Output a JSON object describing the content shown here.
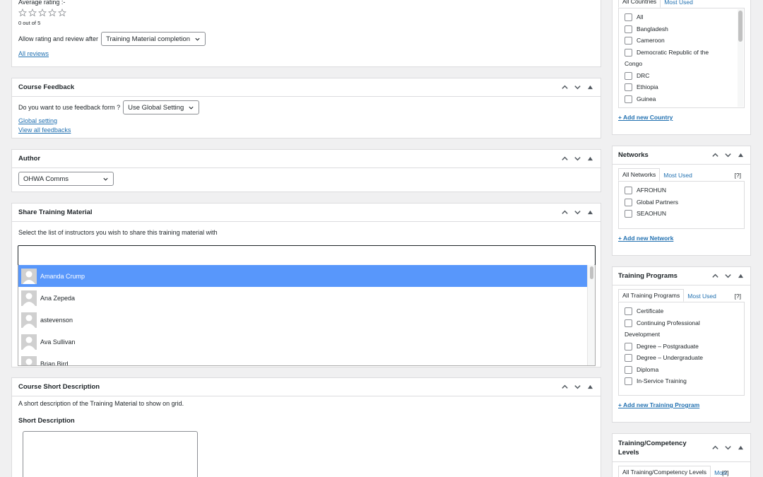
{
  "rating": {
    "avg_label": "Average rating :-",
    "stars": 5,
    "score_text": "0 out of 5",
    "allow_label": "Allow rating and review after",
    "allow_value": "Training Material completion",
    "all_reviews": "All reviews"
  },
  "feedback": {
    "title": "Course Feedback",
    "question": "Do you want to use feedback form ?",
    "value": "Use Global Setting",
    "global_link": "Global setting",
    "view_link": "View all feedbacks"
  },
  "author": {
    "title": "Author",
    "value": "OHWA Comms"
  },
  "share": {
    "title": "Share Training Material",
    "desc": "Select the list of instructors you wish to share this training material with",
    "instructors": [
      "Amanda Crump",
      "Ana Zepeda",
      "astevenson",
      "Ava Sullivan",
      "Brian Bird"
    ]
  },
  "short_desc": {
    "title": "Course Short Description",
    "desc": "A short description of the Training Material to show on grid.",
    "label": "Short Description"
  },
  "countries": {
    "tab_all": "All Countries",
    "tab_most": "Most Used",
    "items": [
      "All",
      "Bangladesh",
      "Cameroon",
      "Democratic Republic of the",
      "Congo",
      "DRC",
      "Ethiopia",
      "Guinea"
    ],
    "add": "+ Add new Country"
  },
  "networks": {
    "title": "Networks",
    "tab_all": "All Networks",
    "tab_most": "Most Used",
    "help": "[?]",
    "items": [
      "AFROHUN",
      "Global Partners",
      "SEAOHUN"
    ],
    "add": "+ Add new Network"
  },
  "programs": {
    "title": "Training Programs",
    "tab_all": "All Training Programs",
    "tab_most": "Most Used",
    "help": "[?]",
    "items": [
      "Certificate",
      "Continuing Professional",
      "Development",
      "Degree – Postgraduate",
      "Degree – Undergraduate",
      "Diploma",
      "In-Service Training"
    ],
    "add": "+ Add new Training Program"
  },
  "levels": {
    "title_1": "Training/Competency",
    "title_2": "Levels",
    "tab_all": "All Training/Competency Levels",
    "tab_most": "Most",
    "help": "[?]"
  },
  "colors": {
    "accent": "#2271b1",
    "highlight": "#5897fb"
  }
}
